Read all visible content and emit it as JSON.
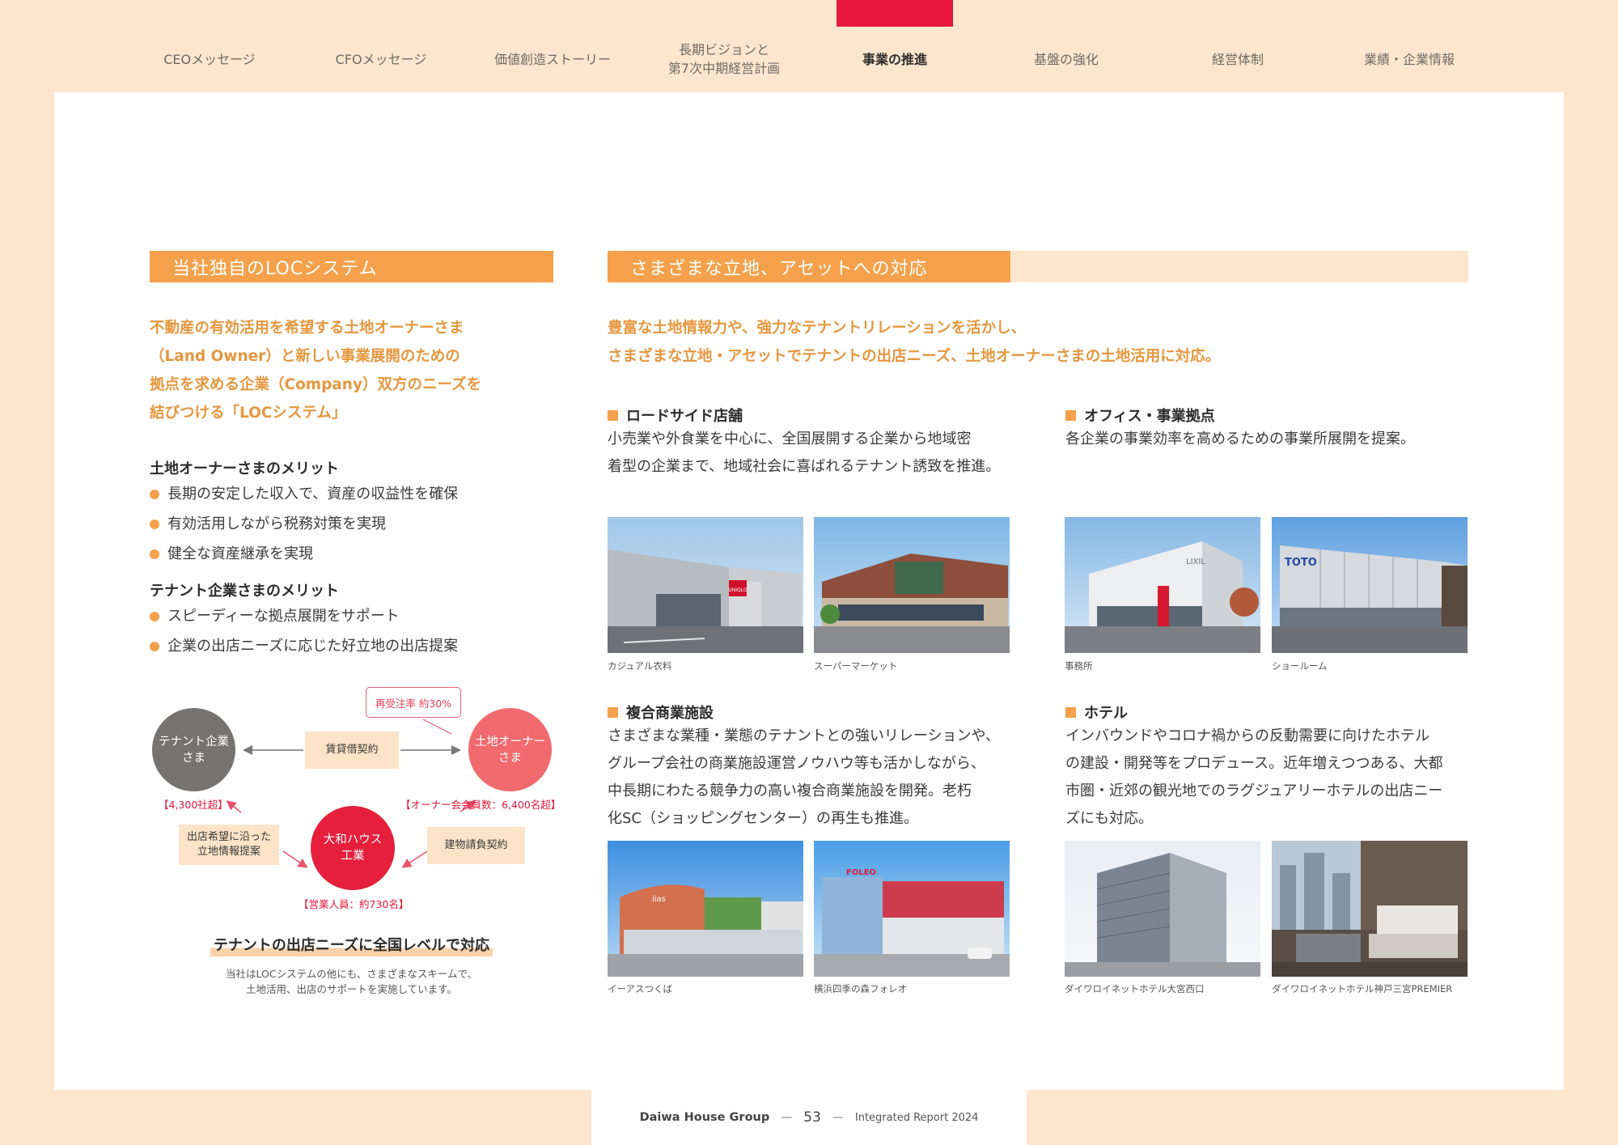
{
  "nav": {
    "items": [
      {
        "label": "CEOメッセージ"
      },
      {
        "label": "CFOメッセージ"
      },
      {
        "label": "価値創造ストーリー"
      },
      {
        "label": "長期ビジョンと\n第7次中期経営計画"
      },
      {
        "label": "事業の推進"
      },
      {
        "label": "基盤の強化"
      },
      {
        "label": "経営体制"
      },
      {
        "label": "業績・企業情報"
      }
    ],
    "active_index": 4,
    "accent_color": "#e8173f"
  },
  "left": {
    "header": "当社独自のLOCシステム",
    "lead": "不動産の有効活用を希望する土地オーナーさま\n（Land Owner）と新しい事業展開のための\n拠点を求める企業（Company）双方のニーズを\n結びつける「LOCシステム」",
    "owner_merits": {
      "title": "土地オーナーさまのメリット",
      "items": [
        "長期の安定した収入で、資産の収益性を確保",
        "有効活用しながら税務対策を実現",
        "健全な資産継承を実現"
      ]
    },
    "tenant_merits": {
      "title": "テナント企業さまのメリット",
      "items": [
        "スピーディーな拠点展開をサポート",
        "企業の出店ニーズに応じた好立地の出店提案"
      ]
    },
    "diagram": {
      "callout": "再受注率 約30%",
      "tenant": "テナント企業\nさま",
      "owner": "土地オーナー\nさま",
      "daiwa": "大和ハウス\n工業",
      "lease": "賃貸借契約",
      "info": "出店希望に沿った\n立地情報提案",
      "build": "建物請負契約",
      "tenant_count": "【4,300社超】",
      "owner_count": "【オーナー会会員数：6,400名超】",
      "sales_count": "【営業人員：約730名】"
    },
    "tagline": "テナントの出店ニーズに全国レベルで対応",
    "note": "当社はLOCシステムの他にも、さまざまなスキームで、\n土地活用、出店のサポートを実施しています。"
  },
  "right": {
    "header": "さまざまな立地、アセットへの対応",
    "lead": "豊富な土地情報力や、強力なテナントリレーションを活かし、\nさまざまな立地・アセットでテナントの出店ニーズ、土地オーナーさまの土地活用に対応。",
    "sections": [
      {
        "title": "ロードサイド店舗",
        "body": "小売業や外食業を中心に、全国展開する企業から地域密\n着型の企業まで、地域社会に喜ばれるテナント誘致を推進。",
        "captions": [
          "カジュアル衣料",
          "スーパーマーケット"
        ]
      },
      {
        "title": "オフィス・事業拠点",
        "body": "各企業の事業効率を高めるための事業所展開を提案。",
        "captions": [
          "事務所",
          "ショールーム"
        ]
      },
      {
        "title": "複合商業施設",
        "body": "さまざまな業種・業態のテナントとの強いリレーションや、\nグループ会社の商業施設運営ノウハウ等も活かしながら、\n中長期にわたる競争力の高い複合商業施設を開発。老朽\n化SC（ショッピングセンター）の再生も推進。",
        "captions": [
          "イーアスつくば",
          "横浜四季の森フォレオ"
        ]
      },
      {
        "title": "ホテル",
        "body": "インバウンドやコロナ禍からの反動需要に向けたホテル\nの建設・開発等をプロデュース。近年増えつつある、大都\n市圏・近郊の観光地でのラグジュアリーホテルの出店ニー\nズにも対応。",
        "captions": [
          "ダイワロイネットホテル大宮西口",
          "ダイワロイネットホテル神戸三宮PREMIER"
        ]
      }
    ],
    "photo_signs": {
      "uniqlo": "UNIQLO",
      "lixil": "LIXIL",
      "toto": "TOTO",
      "iias": "iias",
      "foleo": "FOLEO"
    }
  },
  "footer": {
    "brand": "Daiwa House Group",
    "dash": "—",
    "page": "53",
    "report": "Integrated Report 2024"
  },
  "colors": {
    "orange": "#f5a14c",
    "lead_orange": "#e6973f",
    "background": "#fde6cd",
    "red": "#e51f3c"
  }
}
